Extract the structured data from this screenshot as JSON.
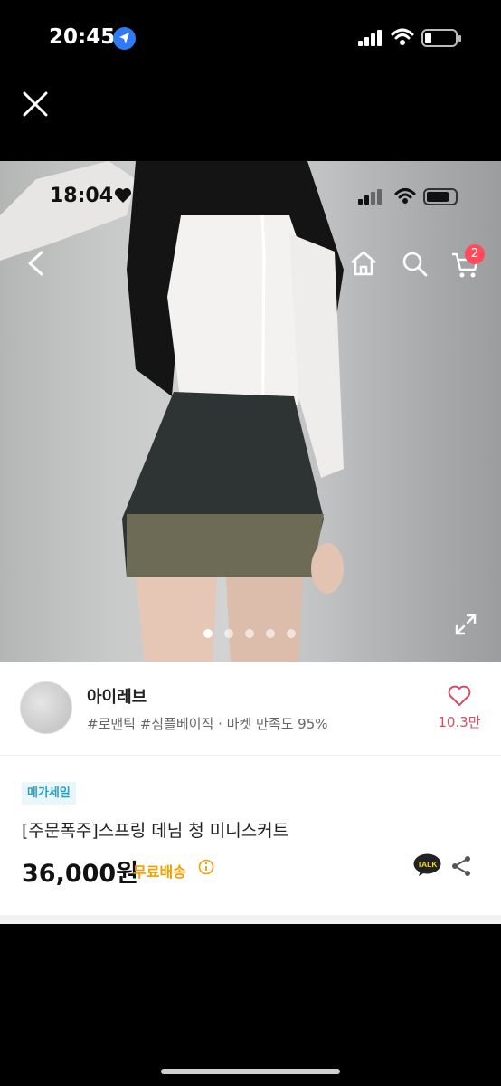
{
  "status_bar": {
    "time": "20:45"
  },
  "inner_status_bar": {
    "time": "18:04"
  },
  "cart": {
    "badge_count": "2"
  },
  "carousel": {
    "total": 5,
    "active_index": 0
  },
  "seller": {
    "name": "아이레브",
    "tags": "#로맨틱 #심플베이직 · 마켓 만족도 95%",
    "likes": "10.3만"
  },
  "product": {
    "badge": "메가세일",
    "title": "[주문폭주]스프링 데님 청 미니스커트",
    "price": "36,000원",
    "shipping": "무료배송",
    "talk_label": "TALK"
  },
  "colors": {
    "accent_pink": "#d94b63",
    "shipping": "#f0a000",
    "badge_bg": "#e9f7fb",
    "badge_text": "#2c9fc0"
  }
}
